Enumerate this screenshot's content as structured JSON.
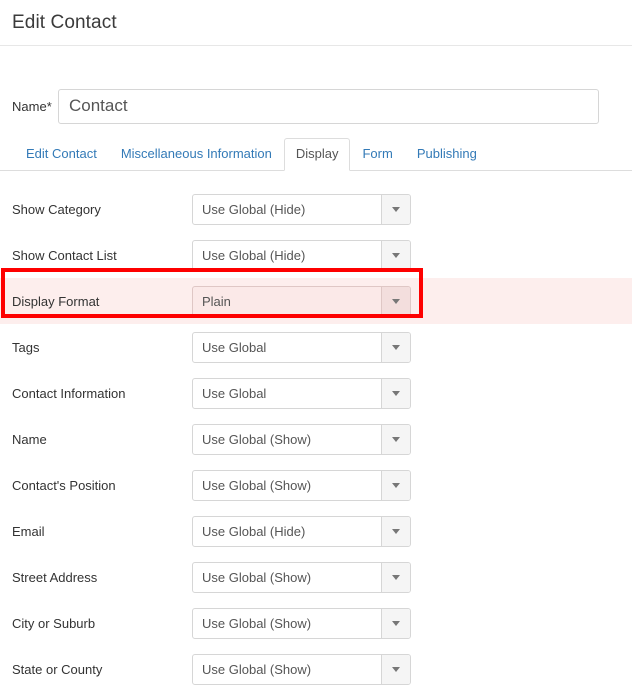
{
  "header": {
    "title": "Edit Contact"
  },
  "name_field": {
    "label": "Name",
    "required_marker": "*",
    "value": "Contact",
    "placeholder": "Contact"
  },
  "tabs": [
    {
      "label": "Edit Contact",
      "active": false
    },
    {
      "label": "Miscellaneous Information",
      "active": false
    },
    {
      "label": "Display",
      "active": true
    },
    {
      "label": "Form",
      "active": false
    },
    {
      "label": "Publishing",
      "active": false
    }
  ],
  "fields": [
    {
      "label": "Show Category",
      "value": "Use Global (Hide)",
      "highlighted": false
    },
    {
      "label": "Show Contact List",
      "value": "Use Global (Hide)",
      "highlighted": false
    },
    {
      "label": "Display Format",
      "value": "Plain",
      "highlighted": true
    },
    {
      "label": "Tags",
      "value": "Use Global",
      "highlighted": false
    },
    {
      "label": "Contact Information",
      "value": "Use Global",
      "highlighted": false
    },
    {
      "label": "Name",
      "value": "Use Global (Show)",
      "highlighted": false
    },
    {
      "label": "Contact's Position",
      "value": "Use Global (Show)",
      "highlighted": false
    },
    {
      "label": "Email",
      "value": "Use Global (Hide)",
      "highlighted": false
    },
    {
      "label": "Street Address",
      "value": "Use Global (Show)",
      "highlighted": false
    },
    {
      "label": "City or Suburb",
      "value": "Use Global (Show)",
      "highlighted": false
    },
    {
      "label": "State or County",
      "value": "Use Global (Show)",
      "highlighted": false
    }
  ],
  "annotation": {
    "highlight_color": "#fe0000",
    "highlight_fill": "#fdeeed",
    "highlight_target": "Display Format"
  },
  "colors": {
    "link": "#337ab7",
    "text": "#333333",
    "border": "#d6d6d6",
    "button_face": "#f5f5f5"
  },
  "icons": {
    "caret": "chevron-down-icon"
  }
}
